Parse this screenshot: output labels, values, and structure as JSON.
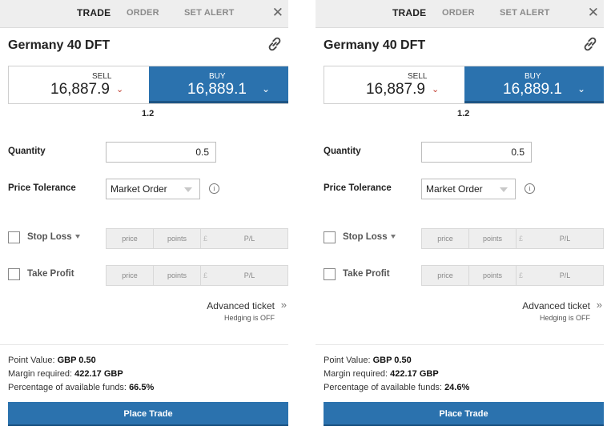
{
  "panels": [
    {
      "tabs": [
        "TRADE",
        "ORDER",
        "SET ALERT"
      ],
      "instrument": "Germany 40 DFT",
      "sell": {
        "label": "SELL",
        "price": "16,887.9"
      },
      "buy": {
        "label": "BUY",
        "price": "16,889.1"
      },
      "spread": "1.2",
      "quantity": {
        "label": "Quantity",
        "value": "0.5"
      },
      "price_tolerance": {
        "label": "Price Tolerance",
        "value": "Market Order"
      },
      "stop_loss": {
        "label": "Stop Loss",
        "fields": [
          "price",
          "points",
          "£",
          "P/L"
        ]
      },
      "take_profit": {
        "label": "Take Profit",
        "fields": [
          "price",
          "points",
          "£",
          "P/L"
        ]
      },
      "advanced_ticket": "Advanced ticket",
      "hedging": "Hedging is OFF",
      "point_value": {
        "label": "Point Value:",
        "value": "GBP 0.50"
      },
      "margin": {
        "label": "Margin required:",
        "value": "422.17 GBP"
      },
      "funds": {
        "label": "Percentage of available funds:",
        "value": "66.5%"
      },
      "place_trade": "Place Trade"
    },
    {
      "tabs": [
        "TRADE",
        "ORDER",
        "SET ALERT"
      ],
      "instrument": "Germany 40 DFT",
      "sell": {
        "label": "SELL",
        "price": "16,887.9"
      },
      "buy": {
        "label": "BUY",
        "price": "16,889.1"
      },
      "spread": "1.2",
      "quantity": {
        "label": "Quantity",
        "value": "0.5"
      },
      "price_tolerance": {
        "label": "Price Tolerance",
        "value": "Market Order"
      },
      "stop_loss": {
        "label": "Stop Loss",
        "fields": [
          "price",
          "points",
          "£",
          "P/L"
        ]
      },
      "take_profit": {
        "label": "Take Profit",
        "fields": [
          "price",
          "points",
          "£",
          "P/L"
        ]
      },
      "advanced_ticket": "Advanced ticket",
      "hedging": "Hedging is OFF",
      "point_value": {
        "label": "Point Value:",
        "value": "GBP 0.50"
      },
      "margin": {
        "label": "Margin required:",
        "value": "422.17 GBP"
      },
      "funds": {
        "label": "Percentage of available funds:",
        "value": "24.6%"
      },
      "place_trade": "Place Trade"
    }
  ],
  "icons": {
    "close": "close-icon",
    "link": "link-icon",
    "info": "info-icon",
    "chevron": "chevron-down-icon",
    "advanced": "double-chevron-right-icon"
  },
  "colors": {
    "buy": "#2b72ae",
    "sell_chevron": "#c0392b",
    "tab_bar": "#eeeeee"
  }
}
